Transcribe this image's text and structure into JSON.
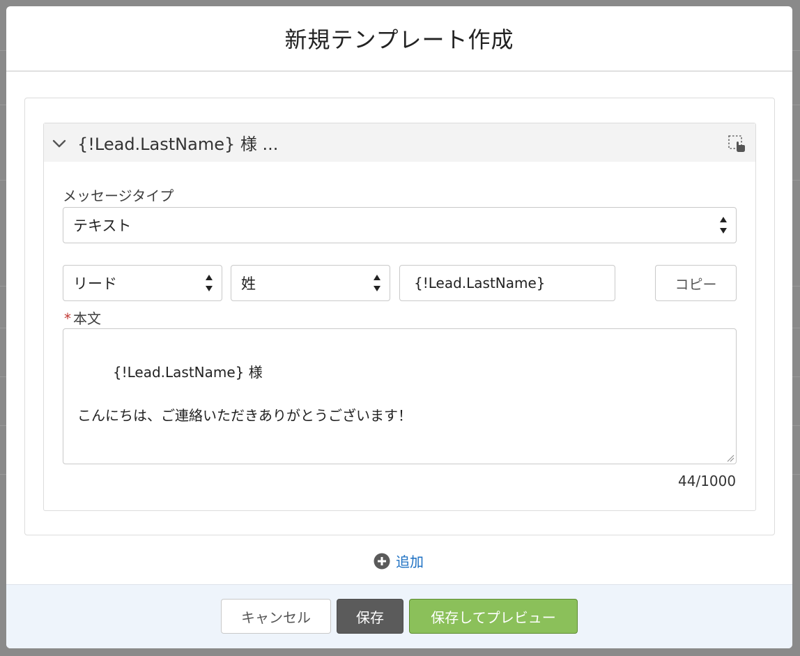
{
  "modal": {
    "title": "新規テンプレート作成"
  },
  "section": {
    "title": "{!Lead.LastName} 様 ...",
    "message_type_label": "メッセージタイプ",
    "message_type_value": "テキスト",
    "object_select_value": "リード",
    "field_select_value": "姓",
    "merge_field_value": "{!Lead.LastName}",
    "copy_label": "コピー",
    "body_label": "本文",
    "body_required_mark": "*",
    "body_text": "{!Lead.LastName} 様\n\nこんにちは、ご連絡いただきありがとうございます！",
    "char_count": "44/1000"
  },
  "add_label": "追加",
  "footer": {
    "cancel_label": "キャンセル",
    "save_label": "保存",
    "save_preview_label": "保存してプレビュー"
  },
  "icons": {
    "chevron": "chevron-down-icon",
    "drag": "drag-handle-icon",
    "add": "add-circle-icon",
    "select_arrows": "sort-arrows-icon"
  },
  "colors": {
    "required": "#c23934",
    "link": "#1b6fc2",
    "save_button": "#5b5b5b",
    "preview_button": "#8bc05a"
  }
}
